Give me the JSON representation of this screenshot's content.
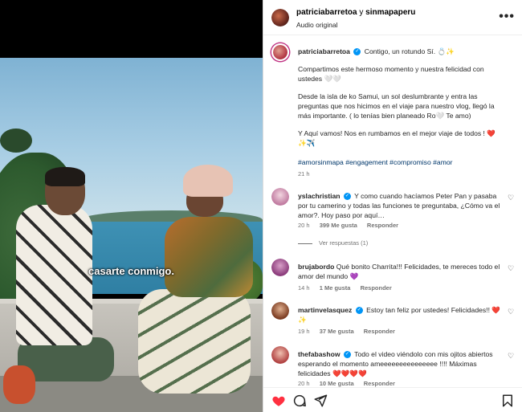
{
  "media": {
    "caption_overlay": "casarte conmigo."
  },
  "header": {
    "user1": "patriciabarretoa",
    "and_text": " y ",
    "user2": "sinmapaperu",
    "audio": "Audio original",
    "more_icon": "more-horizontal-icon"
  },
  "post": {
    "author": "patriciabarretoa",
    "first_line": "Contigo, un rotundo Sí. 💍✨",
    "paragraph1": "Compartimos este hermoso momento y nuestra felicidad con ustedes 🤍🤍",
    "paragraph2": "Desde la isla de ko Samui, un sol deslumbrante y entra las preguntas que nos hicimos en el viaje para nuestro vlog, llegó la más importante. ( lo tenías bien planeado Ro🤍 Te amo)",
    "paragraph3": "Y Aquí vamos! Nos en rumbamos en el mejor viaje de todos ! ❤️ ✨✈️",
    "hashtags": "#amorsinmapa #engagement #compromiso #amor",
    "time": "21 h"
  },
  "comments": [
    {
      "user": "yslachristian",
      "verified": true,
      "text": "Y como cuando hacíamos Peter Pan y pasaba por tu camerino y todas las funciones te preguntaba, ¿Cómo va el amor?. Hoy paso por aquí…",
      "time": "20 h",
      "likes": "399 Me gusta",
      "reply": "Responder",
      "view_replies": "Ver respuestas (1)"
    },
    {
      "user": "brujabordo",
      "verified": false,
      "text": "Qué bonito Charrita!!! Felicidades, te mereces todo el amor del mundo 💜",
      "time": "14 h",
      "likes": "1 Me gusta",
      "reply": "Responder"
    },
    {
      "user": "martinvelasquez",
      "verified": true,
      "text": "Estoy tan feliz por ustedes! Felicidades!! ❤️✨",
      "time": "19 h",
      "likes": "37 Me gusta",
      "reply": "Responder"
    },
    {
      "user": "thefabashow",
      "verified": true,
      "text": "Todo el video viéndolo con mis ojitos abiertos esperando el momento ameeeeeeeeeeeeeee !!!! Máximas felicidades ❤️❤️❤️❤️",
      "time": "20 h",
      "likes": "10 Me gusta",
      "reply": "Responder"
    }
  ],
  "actions": {
    "like_icon": "heart-filled-icon",
    "comment_icon": "comment-icon",
    "share_icon": "share-icon",
    "save_icon": "bookmark-icon",
    "like_color": "#ff3040"
  }
}
